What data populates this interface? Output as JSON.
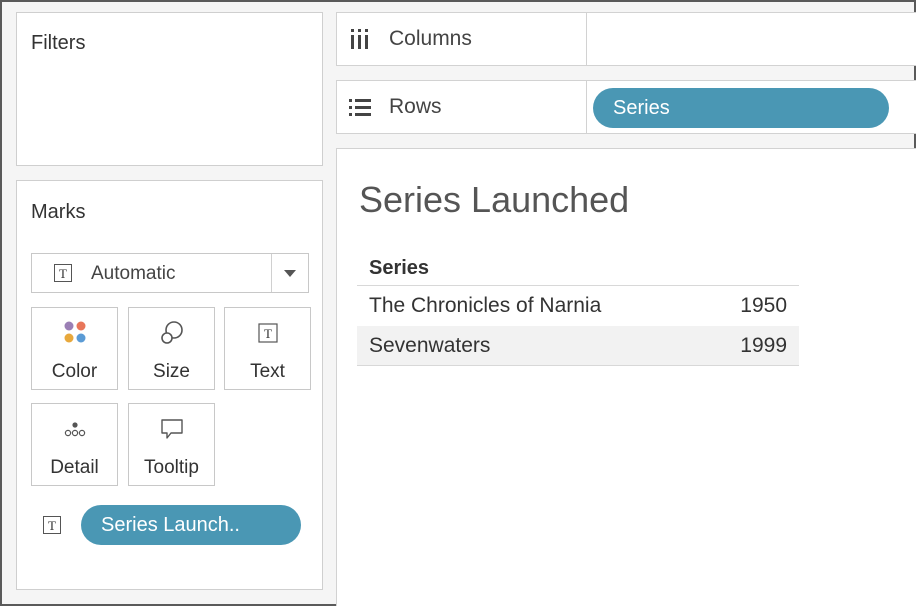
{
  "filters": {
    "title": "Filters"
  },
  "marks": {
    "title": "Marks",
    "mark_type": "Automatic",
    "cards": {
      "color": "Color",
      "size": "Size",
      "text": "Text",
      "detail": "Detail",
      "tooltip": "Tooltip"
    },
    "text_pill": "Series Launch..",
    "color_dots": [
      "#9b7fb5",
      "#e8765a",
      "#e8a83c",
      "#5b9bd5"
    ],
    "pill_color": "#4a97b4"
  },
  "shelves": {
    "columns": {
      "label": "Columns"
    },
    "rows": {
      "label": "Rows",
      "pill": "Series"
    }
  },
  "view": {
    "title": "Series Launched",
    "table": {
      "header": "Series",
      "rows": [
        {
          "name": "The Chronicles of Narnia",
          "value": "1950"
        },
        {
          "name": "Sevenwaters",
          "value": "1999"
        }
      ]
    }
  }
}
